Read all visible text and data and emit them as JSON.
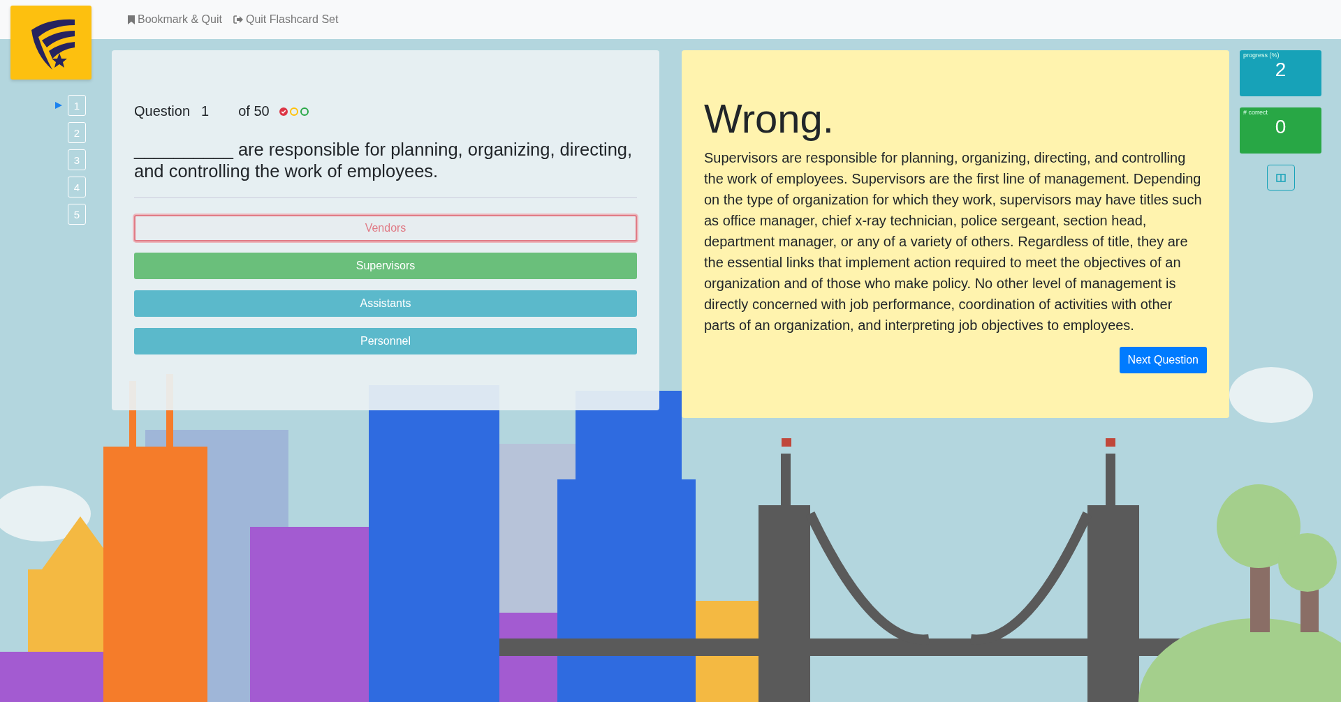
{
  "toolbar": {
    "links": [
      {
        "kind": "bookmark",
        "label": "Bookmark & Quit"
      },
      {
        "kind": "quit",
        "label": "Quit Flashcard Set"
      }
    ]
  },
  "question_nav": [
    {
      "label": "1",
      "selected": true
    },
    {
      "label": "2",
      "selected": false
    },
    {
      "label": "3",
      "selected": false
    },
    {
      "label": "4",
      "selected": false
    },
    {
      "label": "5",
      "selected": false
    }
  ],
  "question": {
    "label": "Question",
    "number": "1",
    "total": "of 50",
    "status_marks": [
      {
        "kind": "checked",
        "color": "#dc3545"
      },
      {
        "kind": "ring",
        "color": "#ffc107"
      },
      {
        "kind": "ring",
        "color": "#28a745"
      }
    ],
    "text": "__________ are responsible for planning, organizing, directing, and controlling the work of employees.",
    "options": [
      {
        "label": "Vendors",
        "kind": "wrong"
      },
      {
        "label": "Supervisors",
        "kind": "correct"
      },
      {
        "label": "Assistants",
        "kind": "plain"
      },
      {
        "label": "Personnel",
        "kind": "plain"
      }
    ]
  },
  "feedback": {
    "heading": "Wrong.",
    "text": "Supervisors are responsible for planning, organizing, directing, and controlling the work of employees. Supervisors are the first line of management. Depending on the type of organization for which they work, supervisors may have titles such as office manager, chief x-ray technician, police sergeant, section head, department manager, or any of a variety of others. Regardless of title, they are the essential links that implement action required to meet the objectives of an organization and of those who make policy. No other level of management is directly concerned with job performance, coordination of activities with other parts of an organization, and interpreting job objectives to employees.",
    "button": "Next Question"
  },
  "stats": [
    {
      "kind": "progress",
      "label": "progress (%)",
      "value": "2"
    },
    {
      "kind": "correct",
      "label": "# correct",
      "value": "0"
    }
  ]
}
